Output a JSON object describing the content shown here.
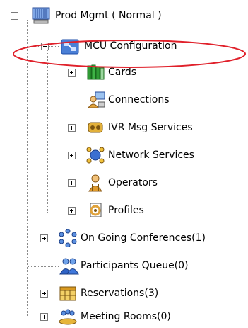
{
  "tree": {
    "root": {
      "label": "Prod Mgmt  ( Normal )",
      "icon": "server-icon",
      "expanded": true
    },
    "mcu": {
      "label": "MCU Configuration",
      "icon": "mcu-config-icon",
      "expanded": true,
      "highlighted": true
    },
    "mcu_children": [
      {
        "label": "Cards",
        "icon": "cards-icon",
        "expandable": true
      },
      {
        "label": "Connections",
        "icon": "connections-icon",
        "expandable": false
      },
      {
        "label": "IVR Msg Services",
        "icon": "ivr-icon",
        "expandable": true
      },
      {
        "label": "Network Services",
        "icon": "network-icon",
        "expandable": true
      },
      {
        "label": "Operators",
        "icon": "operators-icon",
        "expandable": true
      },
      {
        "label": "Profiles",
        "icon": "profiles-icon",
        "expandable": true
      }
    ],
    "root_children": [
      {
        "label": "On Going Conferences(1)",
        "icon": "conferences-icon",
        "expandable": true
      },
      {
        "label": "Participants Queue(0)",
        "icon": "participants-icon",
        "expandable": false
      },
      {
        "label": "Reservations(3)",
        "icon": "reservations-icon",
        "expandable": true
      },
      {
        "label": "Meeting Rooms(0)",
        "icon": "meeting-rooms-icon",
        "expandable": true
      }
    ]
  },
  "colors": {
    "highlight_ellipse": "#e0202a",
    "tree_lines": "#8a8a8a"
  }
}
